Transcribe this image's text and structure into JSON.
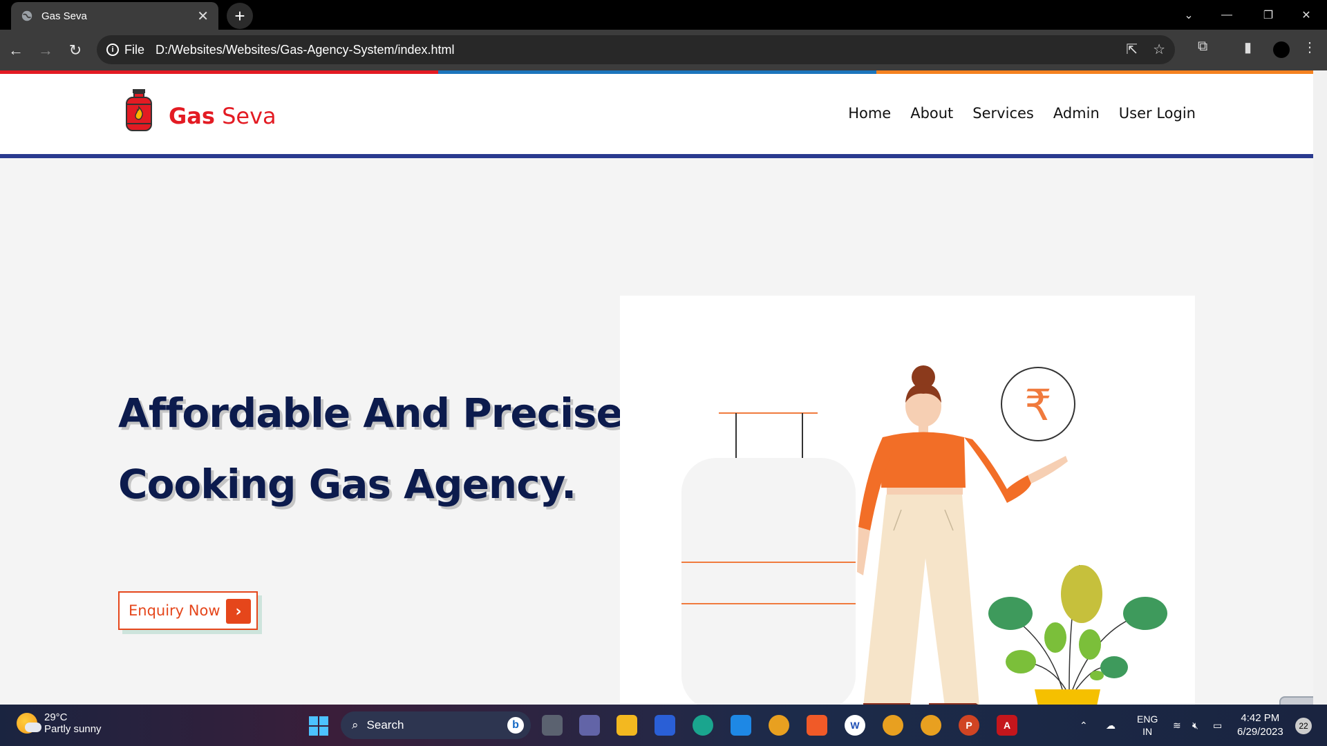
{
  "browser": {
    "tab_title": "Gas Seva",
    "tab_close": "✕",
    "new_tab": "+",
    "url_scheme": "File",
    "url": "D:/Websites/Websites/Gas-Agency-System/index.html"
  },
  "site": {
    "logo_gas": "Gas",
    "logo_seva": "Seva",
    "nav": [
      "Home",
      "About",
      "Services",
      "Admin",
      "User Login"
    ],
    "hero_line1": "Affordable And Precise",
    "hero_line2": "Cooking Gas Agency.",
    "enquiry_label": "Enquiry Now",
    "rupee_symbol": "₹",
    "colors": {
      "brand_red": "#e31b23",
      "navy": "#0c1b4d",
      "accent_orange": "#e5461b",
      "header_underline": "#2a3a8f",
      "top_stripe": [
        "#e31b23",
        "#1c75bc",
        "#f58220"
      ]
    }
  },
  "taskbar": {
    "weather_temp": "29°C",
    "weather_desc": "Partly sunny",
    "search_placeholder": "Search",
    "lang_line1": "ENG",
    "lang_line2": "IN",
    "time": "4:42 PM",
    "date": "6/29/2023",
    "notifications": "22"
  }
}
